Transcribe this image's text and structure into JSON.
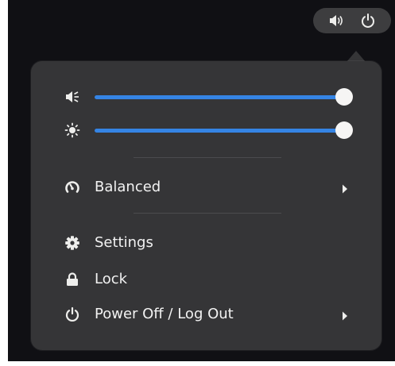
{
  "topbar": {
    "icons": [
      "volume-icon",
      "power-icon"
    ]
  },
  "sliders": {
    "volume": {
      "icon": "volume-muted-icon",
      "level_percent": 100
    },
    "brightness": {
      "icon": "brightness-icon",
      "level_percent": 100
    }
  },
  "power_mode": {
    "label": "Balanced",
    "icon": "power-mode-gauge-icon"
  },
  "menu": {
    "settings_label": "Settings",
    "lock_label": "Lock",
    "power_label": "Power Off / Log Out"
  },
  "colors": {
    "accent": "#3584e4",
    "menu_bg": "#353537",
    "desktop_bg": "#101014"
  }
}
